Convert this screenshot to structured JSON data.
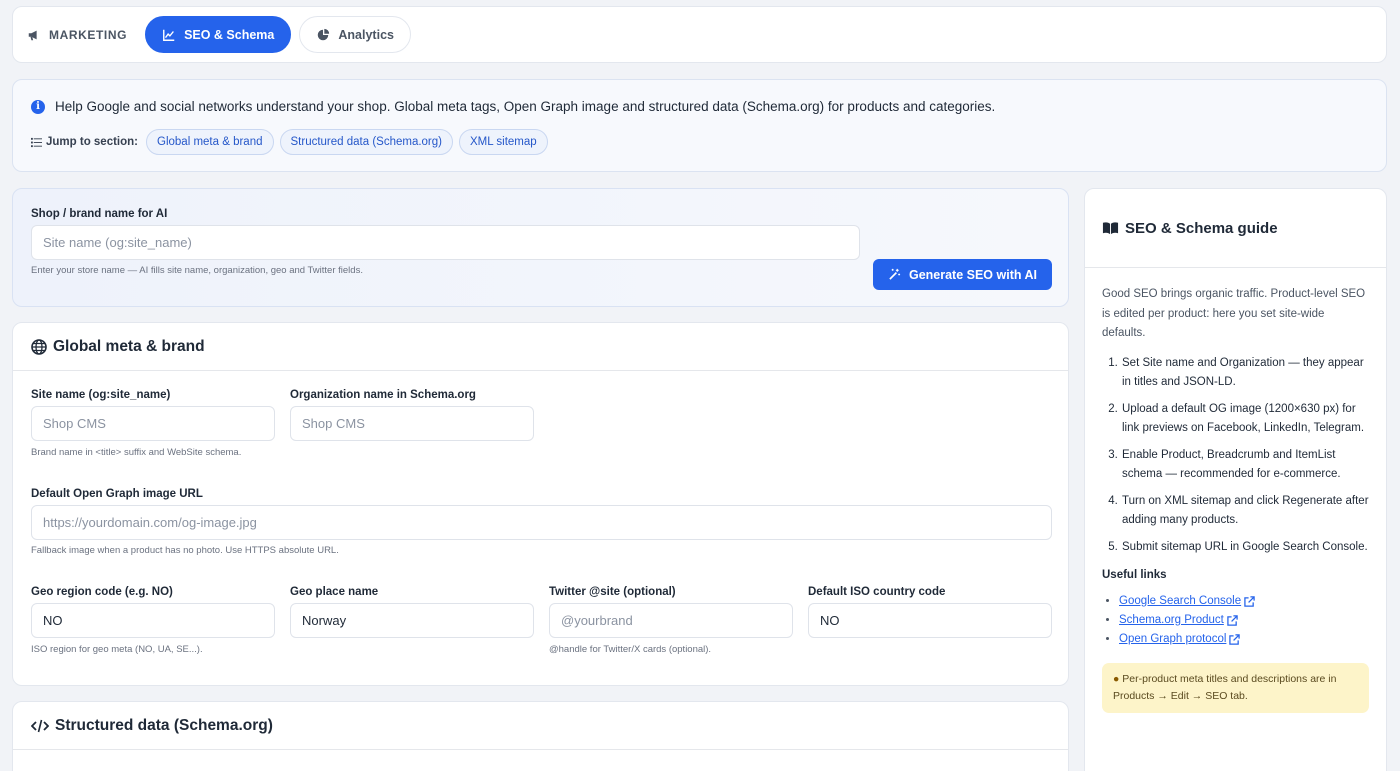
{
  "tabs": {
    "marketing": "MARKETING",
    "seo": "SEO & Schema",
    "analytics": "Analytics"
  },
  "banner": {
    "text": "Help Google and social networks understand your shop. Global meta tags, Open Graph image and structured data (Schema.org) for products and categories.",
    "jump_label": "Jump to section:",
    "chips": [
      "Global meta & brand",
      "Structured data (Schema.org)",
      "XML sitemap"
    ]
  },
  "ai": {
    "label": "Shop / brand name for AI",
    "placeholder": "Site name (og:site_name)",
    "help": "Enter your store name — AI fills site name, organization, geo and Twitter fields.",
    "button": "Generate SEO with AI"
  },
  "global": {
    "title": "Global meta & brand",
    "site_name_label": "Site name (og:site_name)",
    "site_name_placeholder": "Shop CMS",
    "site_name_help": "Brand name in <title> suffix and WebSite schema.",
    "org_label": "Organization name in Schema.org",
    "org_placeholder": "Shop CMS",
    "og_label": "Default Open Graph image URL",
    "og_placeholder": "https://yourdomain.com/og-image.jpg",
    "og_help": "Fallback image when a product has no photo. Use HTTPS absolute URL.",
    "geo_region_label": "Geo region code (e.g. NO)",
    "geo_region_value": "NO",
    "geo_region_help": "ISO region for geo meta (NO, UA, SE...).",
    "geo_place_label": "Geo place name",
    "geo_place_value": "Norway",
    "twitter_label": "Twitter @site (optional)",
    "twitter_placeholder": "@yourbrand",
    "twitter_help": "@handle for Twitter/X cards (optional).",
    "iso_label": "Default ISO country code",
    "iso_value": "NO"
  },
  "schema": {
    "title": "Structured data (Schema.org)"
  },
  "guide": {
    "title": "SEO & Schema guide",
    "intro": "Good SEO brings organic traffic. Product-level SEO is edited per product: here you set site-wide defaults.",
    "steps": [
      "Set Site name and Organization — they appear in titles and JSON-LD.",
      "Upload a default OG image (1200×630 px) for link previews on Facebook, LinkedIn, Telegram.",
      "Enable Product, Breadcrumb and ItemList schema — recommended for e-commerce.",
      "Turn on XML sitemap and click Regenerate after adding many products.",
      "Submit sitemap URL in Google Search Console."
    ],
    "useful_title": "Useful links",
    "links": [
      "Google Search Console",
      "Schema.org Product",
      "Open Graph protocol"
    ],
    "tip": "Per-product meta titles and descriptions are in Products → Edit → SEO tab."
  },
  "colors": {
    "accent": "#2563eb",
    "tip_bg": "#fdf4c9"
  }
}
